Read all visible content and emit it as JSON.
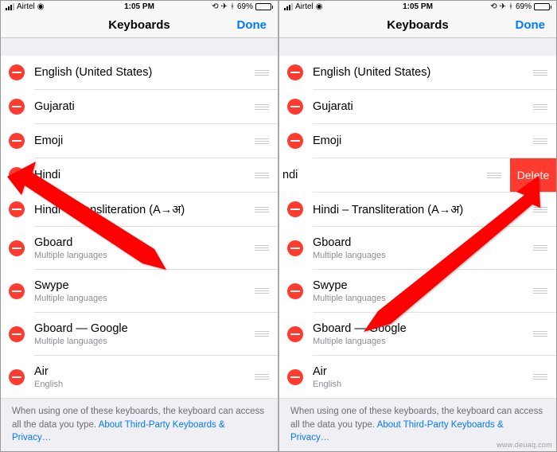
{
  "statusBar": {
    "carrier": "Airtel",
    "time": "1:05 PM",
    "batteryPct": "69%"
  },
  "nav": {
    "title": "Keyboards",
    "done": "Done"
  },
  "rows": [
    {
      "title": "English (United States)",
      "sub": ""
    },
    {
      "title": "Gujarati",
      "sub": ""
    },
    {
      "title": "Emoji",
      "sub": ""
    },
    {
      "title": "Hindi",
      "sub": ""
    },
    {
      "title": "Hindi – Transliteration (A→अ)",
      "sub": ""
    },
    {
      "title": "Gboard",
      "sub": "Multiple languages"
    },
    {
      "title": "Swype",
      "sub": "Multiple languages"
    },
    {
      "title": "Gboard — Google",
      "sub": "Multiple languages"
    },
    {
      "title": "Air",
      "sub": "English"
    }
  ],
  "rightPanel": {
    "hindiShifted": "ndi",
    "deleteLabel": "Delete"
  },
  "footer": {
    "text": "When using one of these keyboards, the keyboard can access all the data you type. ",
    "link": "About Third-Party Keyboards & Privacy…"
  },
  "watermark": "www.deuaq.com"
}
